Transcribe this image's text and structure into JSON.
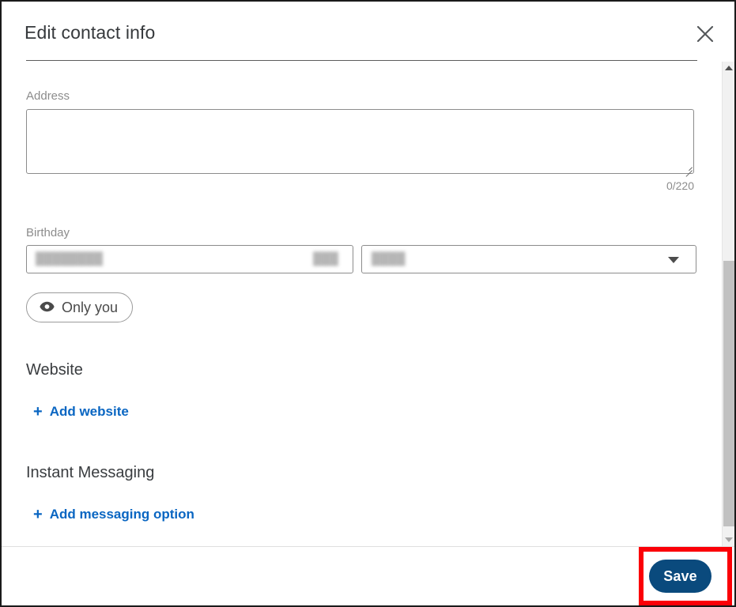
{
  "modal": {
    "title": "Edit contact info",
    "close_label": "Close",
    "close_icon": "close-icon"
  },
  "address": {
    "label": "Address",
    "value": "",
    "placeholder": "",
    "counter": "0/220",
    "max_length": 220
  },
  "birthday": {
    "label": "Birthday",
    "month_value": "████████",
    "month_suffix": "███",
    "day_value": "████",
    "dropdown_icon": "chevron-down-icon",
    "privacy": {
      "label": "Only you",
      "icon": "eye-icon"
    }
  },
  "website": {
    "heading": "Website",
    "add_label": "Add website",
    "add_icon": "plus-icon"
  },
  "instant_messaging": {
    "heading": "Instant Messaging",
    "add_label": "Add messaging option",
    "add_icon": "plus-icon"
  },
  "scrollbar": {
    "up_icon": "caret-up-icon",
    "down_icon": "caret-down-icon"
  },
  "footer": {
    "save_label": "Save"
  },
  "colors": {
    "accent_link": "#0a66c2",
    "save_button": "#0a4a7d",
    "highlight": "#fb0007",
    "label_text": "#8c8c8c",
    "heading_text": "#3a3d40",
    "scroll_thumb": "#c1c1c1"
  }
}
